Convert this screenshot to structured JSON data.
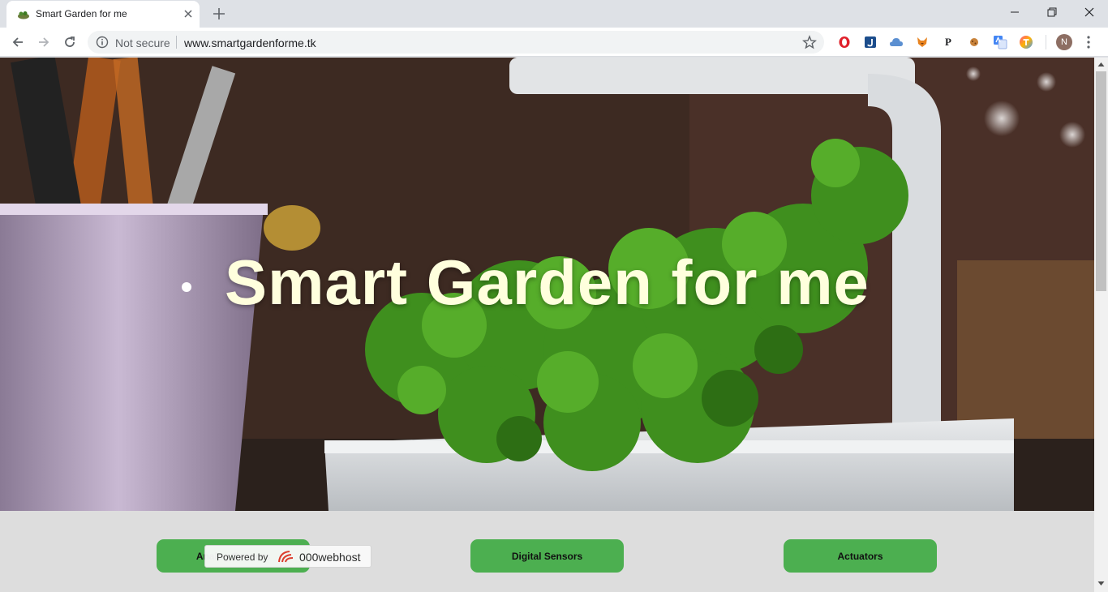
{
  "browser": {
    "tab": {
      "title": "Smart Garden for me",
      "favicon": "garden-favicon"
    },
    "omnibox": {
      "security_label": "Not secure",
      "url": "www.smartgardenforme.tk"
    },
    "profile_initial": "N",
    "extensions": [
      "opera-icon",
      "j-extension-icon",
      "cloud-icon",
      "fox-icon",
      "p-extension-icon",
      "cookie-icon",
      "google-translate-icon",
      "tinted-t-icon"
    ],
    "extension_text": {
      "p_extension": "P"
    }
  },
  "page": {
    "hero_title": "Smart Garden for me",
    "nav": [
      {
        "label": "Analog Sensors"
      },
      {
        "label": "Digital Sensors"
      },
      {
        "label": "Actuators"
      }
    ],
    "hosting_badge": {
      "label": "Powered by",
      "brand": "000webhost"
    },
    "colors": {
      "accent": "#4caf50",
      "hero_title": "#ffffdd",
      "page_bg": "#dddddd"
    }
  }
}
